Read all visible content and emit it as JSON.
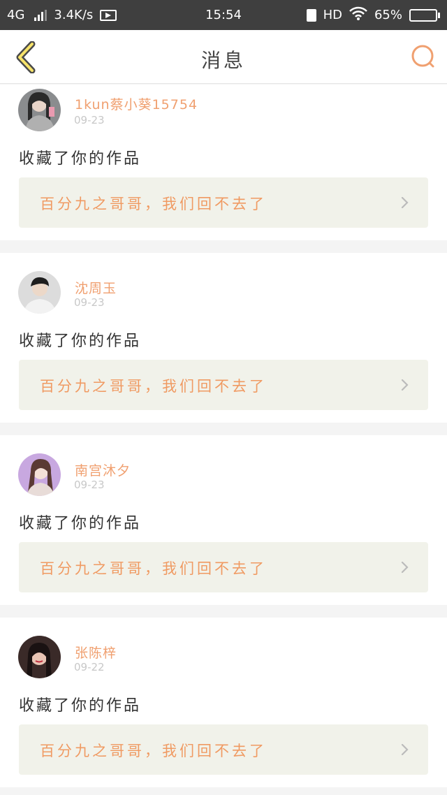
{
  "status_bar": {
    "network": "4G",
    "speed": "3.4K/s",
    "time": "15:54",
    "hd": "HD",
    "battery_percent": "65%",
    "battery_level": 0.65
  },
  "header": {
    "title": "消息",
    "accent_color": "#f0a070"
  },
  "notifications": [
    {
      "user": "1kun蔡小葵15754",
      "date": "09-23",
      "action": "收藏了你的作品",
      "work_title": "百分九之哥哥，我们回不去了"
    },
    {
      "user": "沈周玉",
      "date": "09-23",
      "action": "收藏了你的作品",
      "work_title": "百分九之哥哥，我们回不去了"
    },
    {
      "user": "南宫沐夕",
      "date": "09-23",
      "action": "收藏了你的作品",
      "work_title": "百分九之哥哥，我们回不去了"
    },
    {
      "user": "张陈梓",
      "date": "09-22",
      "action": "收藏了你的作品",
      "work_title": "百分九之哥哥，我们回不去了"
    }
  ]
}
